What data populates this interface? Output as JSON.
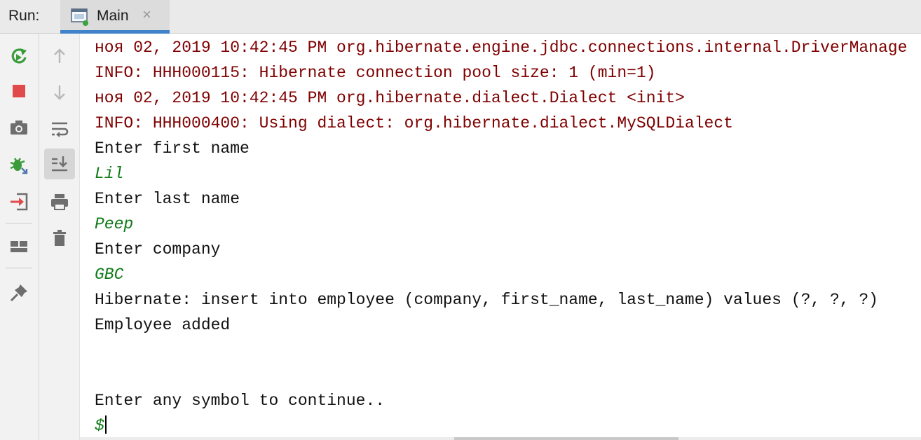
{
  "header": {
    "run_label": "Run:",
    "tab": {
      "title": "Main",
      "close_glyph": "×"
    }
  },
  "left_toolbar": [
    {
      "icon": "rerun-icon",
      "color": "#3a9b3a"
    },
    {
      "icon": "stop-icon",
      "color": "#e04a4a"
    },
    {
      "icon": "camera-icon",
      "color": "#6e6e6e"
    },
    {
      "icon": "debug-bug-icon",
      "color": "#3a9b3a"
    },
    {
      "icon": "exit-icon",
      "color": "#e04a4a"
    },
    {
      "icon": "layout-icon",
      "color": "#6e6e6e"
    },
    {
      "icon": "pin-icon",
      "color": "#6e6e6e"
    }
  ],
  "right_toolbar": [
    {
      "icon": "arrow-up-icon"
    },
    {
      "icon": "arrow-down-icon"
    },
    {
      "icon": "soft-wrap-icon"
    },
    {
      "icon": "scroll-to-end-icon",
      "active": true
    },
    {
      "icon": "print-icon"
    },
    {
      "icon": "trash-icon"
    }
  ],
  "console": {
    "lines": [
      {
        "text": "ноя 02, 2019 10:42:45 PM org.hibernate.engine.jdbc.connections.internal.DriverManage",
        "kind": "err"
      },
      {
        "text": "INFO: HHH000115: Hibernate connection pool size: 1 (min=1)",
        "kind": "err"
      },
      {
        "text": "ноя 02, 2019 10:42:45 PM org.hibernate.dialect.Dialect <init>",
        "kind": "err"
      },
      {
        "text": "INFO: HHH000400: Using dialect: org.hibernate.dialect.MySQLDialect",
        "kind": "err"
      },
      {
        "text": "Enter first name",
        "kind": "out"
      },
      {
        "text": "Lil",
        "kind": "in"
      },
      {
        "text": "Enter last name",
        "kind": "out"
      },
      {
        "text": "Peep",
        "kind": "in"
      },
      {
        "text": "Enter company",
        "kind": "out"
      },
      {
        "text": "GBC",
        "kind": "in"
      },
      {
        "text": "Hibernate: insert into employee (company, first_name, last_name) values (?, ?, ?)",
        "kind": "out"
      },
      {
        "text": "Employee added",
        "kind": "out"
      },
      {
        "text": "",
        "kind": "out"
      },
      {
        "text": "",
        "kind": "out"
      },
      {
        "text": "Enter any symbol to continue..",
        "kind": "out"
      },
      {
        "text": "$",
        "kind": "in"
      }
    ]
  },
  "colors": {
    "stderr": "#7f0000",
    "stdout": "#111111",
    "stdin": "#0e7a17",
    "tab_accent": "#4083c9"
  }
}
